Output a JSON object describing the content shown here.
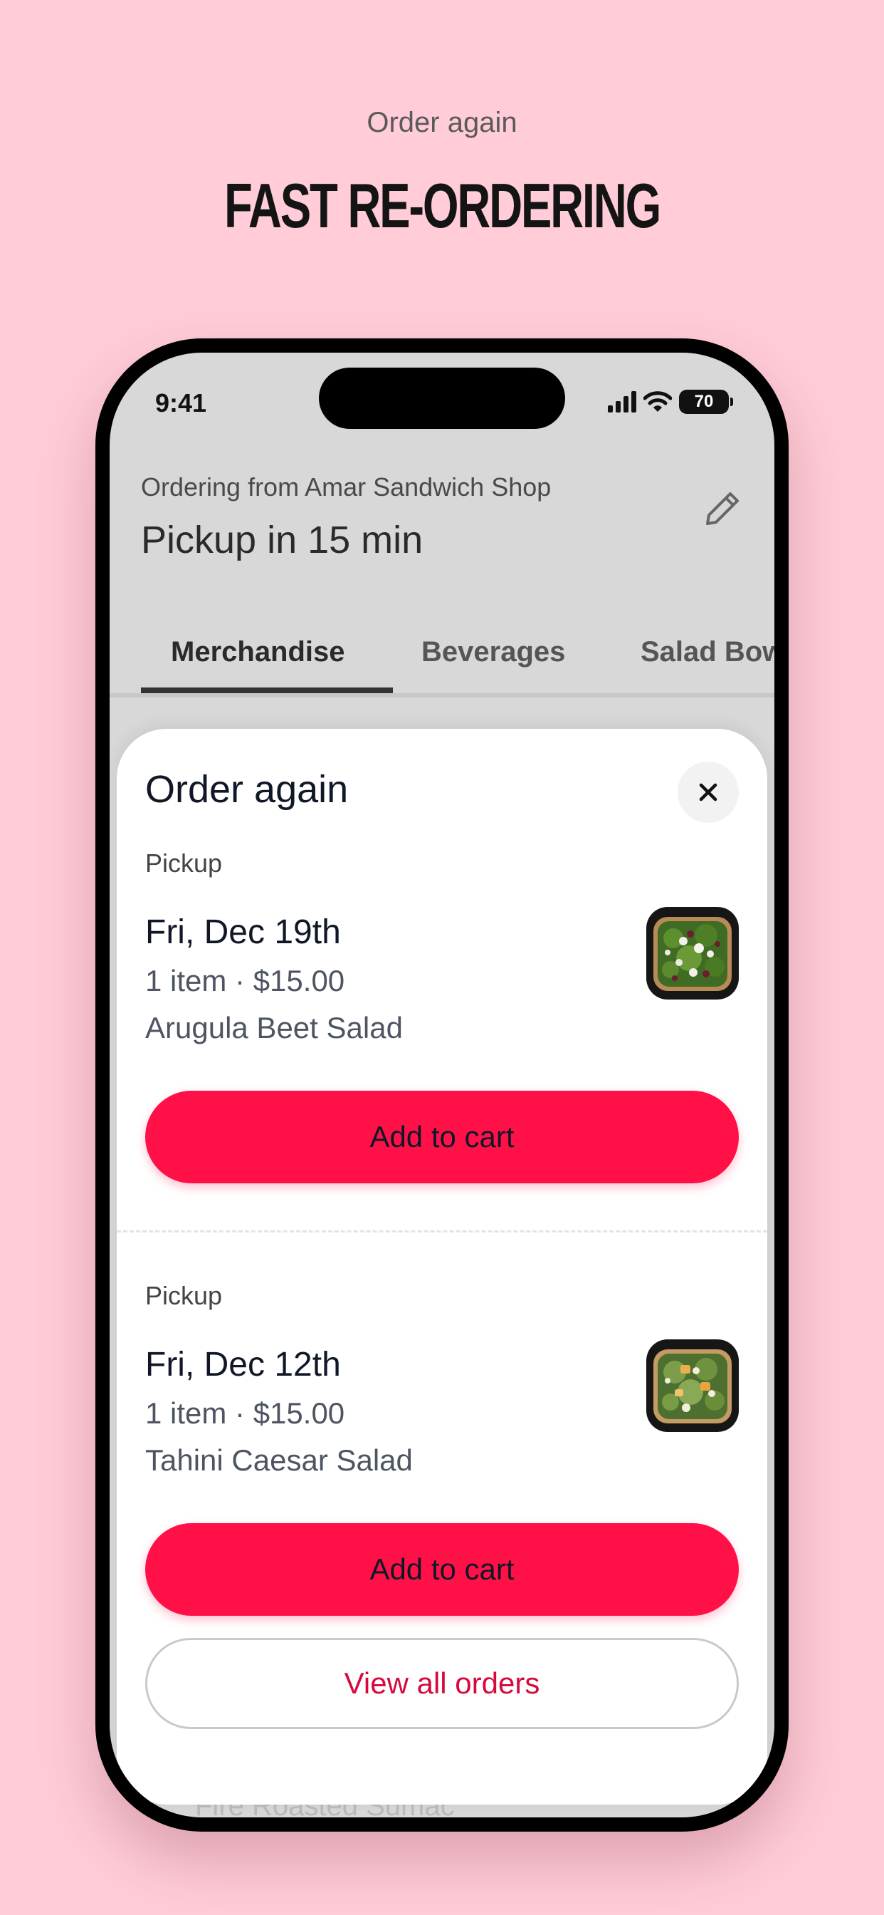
{
  "promo": {
    "subtitle": "Order again",
    "title": "FAST RE-ORDERING"
  },
  "status_bar": {
    "time": "9:41",
    "battery": "70"
  },
  "header": {
    "ordering_from": "Ordering from Amar Sandwich Shop",
    "pickup_time": "Pickup in 15 min"
  },
  "tabs": [
    {
      "label": "Merchandise",
      "active": true
    },
    {
      "label": "Beverages",
      "active": false
    },
    {
      "label": "Salad Bowls",
      "active": false
    }
  ],
  "background_text": "Fire Roasted Sumac",
  "sheet": {
    "title": "Order again",
    "orders": [
      {
        "mode": "Pickup",
        "date": "Fri, Dec 19th",
        "meta": "1 item · $15.00",
        "item": "Arugula Beet Salad",
        "button": "Add to cart"
      },
      {
        "mode": "Pickup",
        "date": "Fri, Dec 12th",
        "meta": "1 item · $15.00",
        "item": "Tahini Caesar Salad",
        "button": "Add to cart"
      }
    ],
    "view_all": "View all orders"
  },
  "colors": {
    "background": "#FFCCD8",
    "accent": "#FF1148",
    "link": "#D6093C"
  },
  "icons": {
    "edit": "pencil-icon",
    "close": "close-icon",
    "signal": "signal-icon",
    "wifi": "wifi-icon",
    "battery": "battery-icon"
  }
}
